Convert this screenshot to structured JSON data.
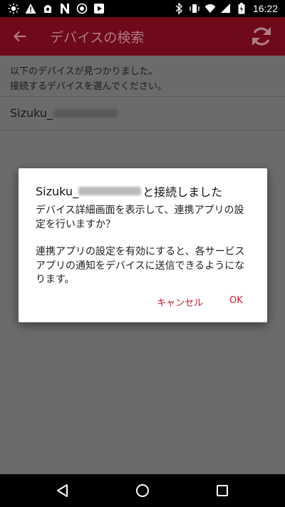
{
  "status_bar": {
    "time": "16:22",
    "left_icons": [
      "brightness-icon",
      "warning-icon",
      "app-icon",
      "n-icon",
      "record-icon",
      "play-icon"
    ],
    "right_icons": [
      "bluetooth-icon",
      "vibrate-icon",
      "wifi-icon",
      "signal-icon",
      "battery-icon"
    ]
  },
  "toolbar": {
    "title": "デバイスの検索",
    "background": "#6e0a1a"
  },
  "content": {
    "info_line1": "以下のデバイスが見つかりました。",
    "info_line2": "接続するデバイスを選んでください。",
    "device_prefix": "Sizuku_"
  },
  "dialog": {
    "title_prefix": "Sizuku_",
    "title_suffix": "と接続しました",
    "paragraph1": "デバイス詳細画面を表示して、連携アプリの設定を行いますか？",
    "paragraph2": "連携アプリの設定を有効にすると、各サービスアプリの通知をデバイスに送信できるようになります。",
    "cancel_label": "キャンセル",
    "ok_label": "OK",
    "accent": "#c41a2e"
  }
}
